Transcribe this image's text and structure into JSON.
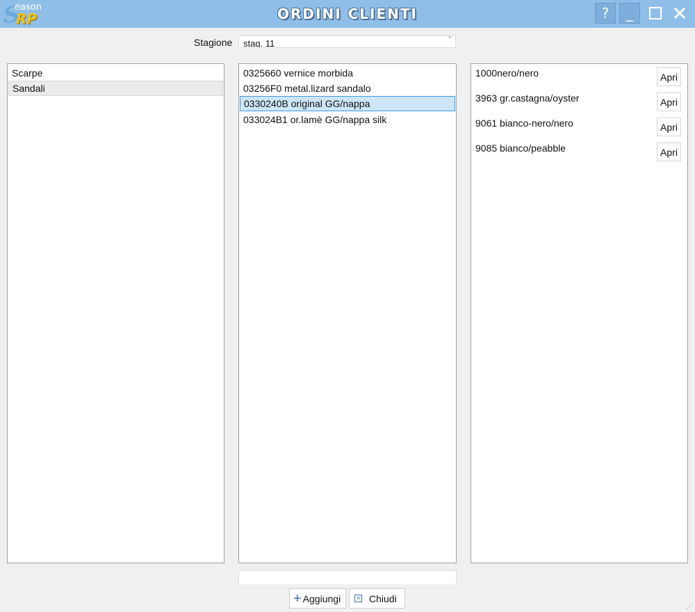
{
  "window": {
    "logo": {
      "initial": "S",
      "small": "eason",
      "big": "RP"
    },
    "title": "ORDINI CLIENTI",
    "buttons": {
      "help": "?",
      "minimize": "_",
      "close": "✕"
    }
  },
  "season": {
    "label": "Stagione",
    "value": "stag. 11",
    "chevron": "ˇ"
  },
  "categories": {
    "items": [
      {
        "label": "Scarpe"
      },
      {
        "label": "Sandali"
      }
    ],
    "selected": "Sandali"
  },
  "articles": {
    "items": [
      {
        "label": "0325660 vernice morbida"
      },
      {
        "label": "03256F0 metal.lizard sandalo"
      },
      {
        "label": "0330240B original GG/nappa"
      },
      {
        "label": "033024B1 or.lamè GG/nappa silk"
      }
    ],
    "selected": "0330240B original GG/nappa"
  },
  "colors": {
    "items": [
      {
        "label": "1000nero/nero",
        "button": "Apri"
      },
      {
        "label": "3963 gr.castagna/oyster",
        "button": "Apri"
      },
      {
        "label": "9061 bianco-nero/nero",
        "button": "Apri"
      },
      {
        "label": "9085 bianco/peabble",
        "button": "Apri"
      }
    ]
  },
  "footer": {
    "add_label": "Aggiungi",
    "add_icon": "+",
    "close_label": "Chiudi",
    "close_icon": "☒"
  },
  "theme": {
    "titlebar": "#8fbfe8",
    "selection_blue": "#cde6f7",
    "selection_border": "#3c9adf",
    "accent_icon": "#3b6fb5"
  }
}
